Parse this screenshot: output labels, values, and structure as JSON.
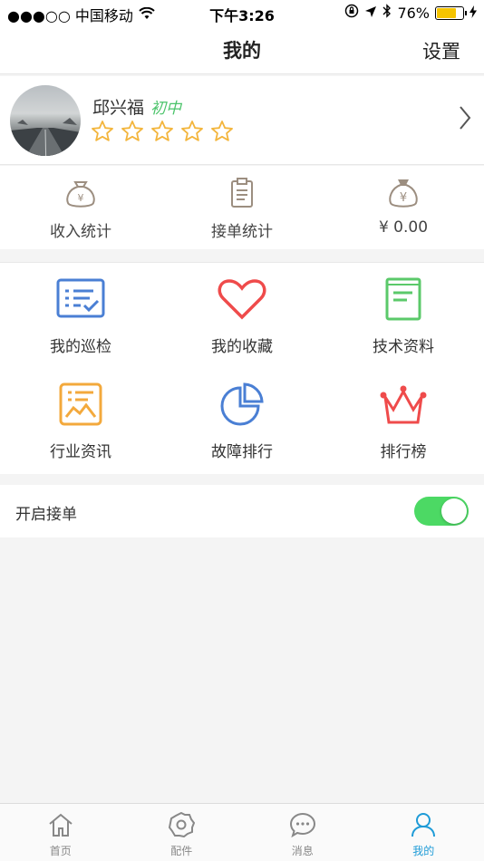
{
  "status_bar": {
    "carrier": "●●●○○ 中国移动",
    "time": "下午3:26",
    "battery": "76%",
    "battery_level": 0.76
  },
  "nav": {
    "title": "我的",
    "settings": "设置"
  },
  "profile": {
    "name": "邱兴福",
    "level": "初中",
    "stars_filled": 0,
    "stars_total": 5
  },
  "stats": [
    {
      "label": "收入统计",
      "icon": "money-bag-icon"
    },
    {
      "label": "接单统计",
      "icon": "clipboard-icon"
    },
    {
      "label": "¥ 0.00",
      "icon": "money-bag-icon"
    }
  ],
  "menu": [
    {
      "label": "我的巡检",
      "icon": "inspection-icon",
      "color": "#4a7fd4"
    },
    {
      "label": "我的收藏",
      "icon": "heart-icon",
      "color": "#ef4b4b"
    },
    {
      "label": "技术资料",
      "icon": "book-icon",
      "color": "#5bc96a"
    },
    {
      "label": "行业资讯",
      "icon": "news-chart-icon",
      "color": "#f3a93c"
    },
    {
      "label": "故障排行",
      "icon": "pie-chart-icon",
      "color": "#4a7fd4"
    },
    {
      "label": "排行榜",
      "icon": "crown-icon",
      "color": "#ef4b4b"
    }
  ],
  "order_toggle": {
    "label": "开启接单",
    "on": true
  },
  "tabs": [
    {
      "label": "首页",
      "icon": "home-icon",
      "active": false
    },
    {
      "label": "配件",
      "icon": "gear-icon",
      "active": false
    },
    {
      "label": "消息",
      "icon": "chat-icon",
      "active": false
    },
    {
      "label": "我的",
      "icon": "user-icon",
      "active": true
    }
  ],
  "colors": {
    "accent": "#1e9bd7",
    "toggle_on": "#4cd964",
    "star": "#f3b53c",
    "level": "#4cc46b"
  }
}
